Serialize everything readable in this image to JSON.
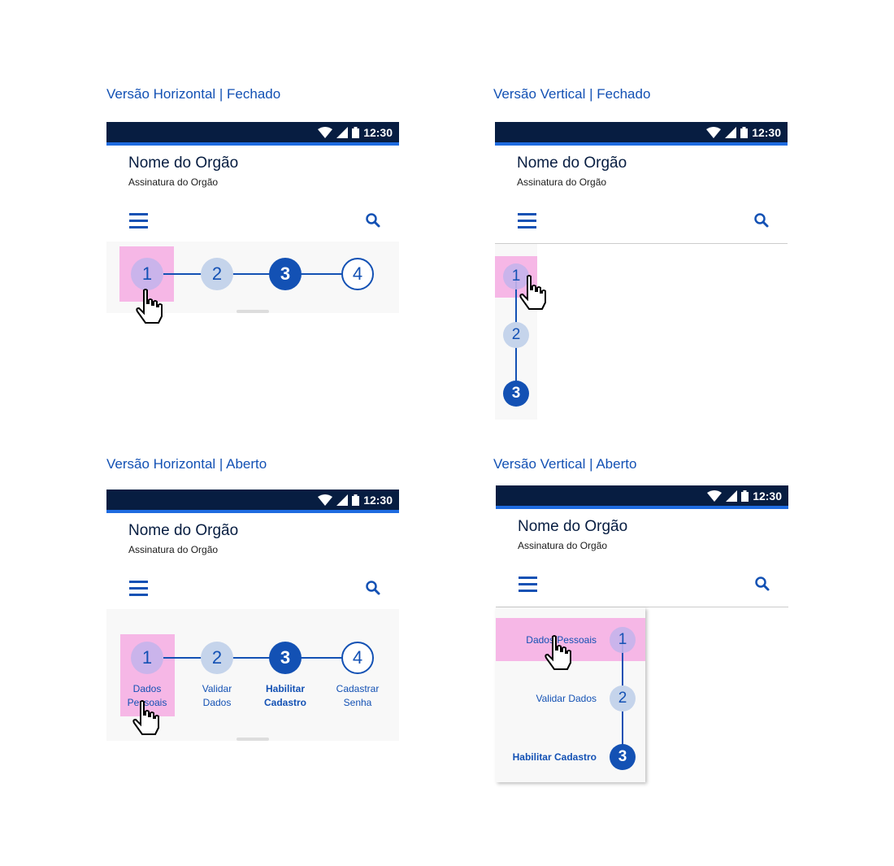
{
  "sections": [
    {
      "title": "Versão Horizontal | Fechado"
    },
    {
      "title": "Versão Vertical | Fechado"
    },
    {
      "title": "Versão Horizontal | Aberto"
    },
    {
      "title": "Versão Vertical | Aberto"
    }
  ],
  "app": {
    "status_time": "12:30",
    "org_name": "Nome do Orgão",
    "org_subtitle": "Assinatura do Orgão"
  },
  "steps": [
    {
      "number": "1",
      "label_line1": "Dados",
      "label_line2": "Pessoais",
      "label": "Dados Pessoais",
      "state": "active-hover"
    },
    {
      "number": "2",
      "label_line1": "Validar",
      "label_line2": "Dados",
      "label": "Validar Dados",
      "state": "done"
    },
    {
      "number": "3",
      "label_line1": "Habilitar",
      "label_line2": "Cadastro",
      "label": "Habilitar Cadastro",
      "state": "current"
    },
    {
      "number": "4",
      "label_line1": "Cadastrar",
      "label_line2": "Senha",
      "label": "Cadastrar Senha",
      "state": "pending"
    }
  ],
  "colors": {
    "primary": "#1351b4",
    "status_bar": "#071d41",
    "status_accent": "#1e6be0",
    "highlight": "#f476d4"
  },
  "icons": [
    "wifi-icon",
    "signal-icon",
    "battery-icon",
    "menu-icon",
    "search-icon",
    "hand-cursor-icon"
  ]
}
